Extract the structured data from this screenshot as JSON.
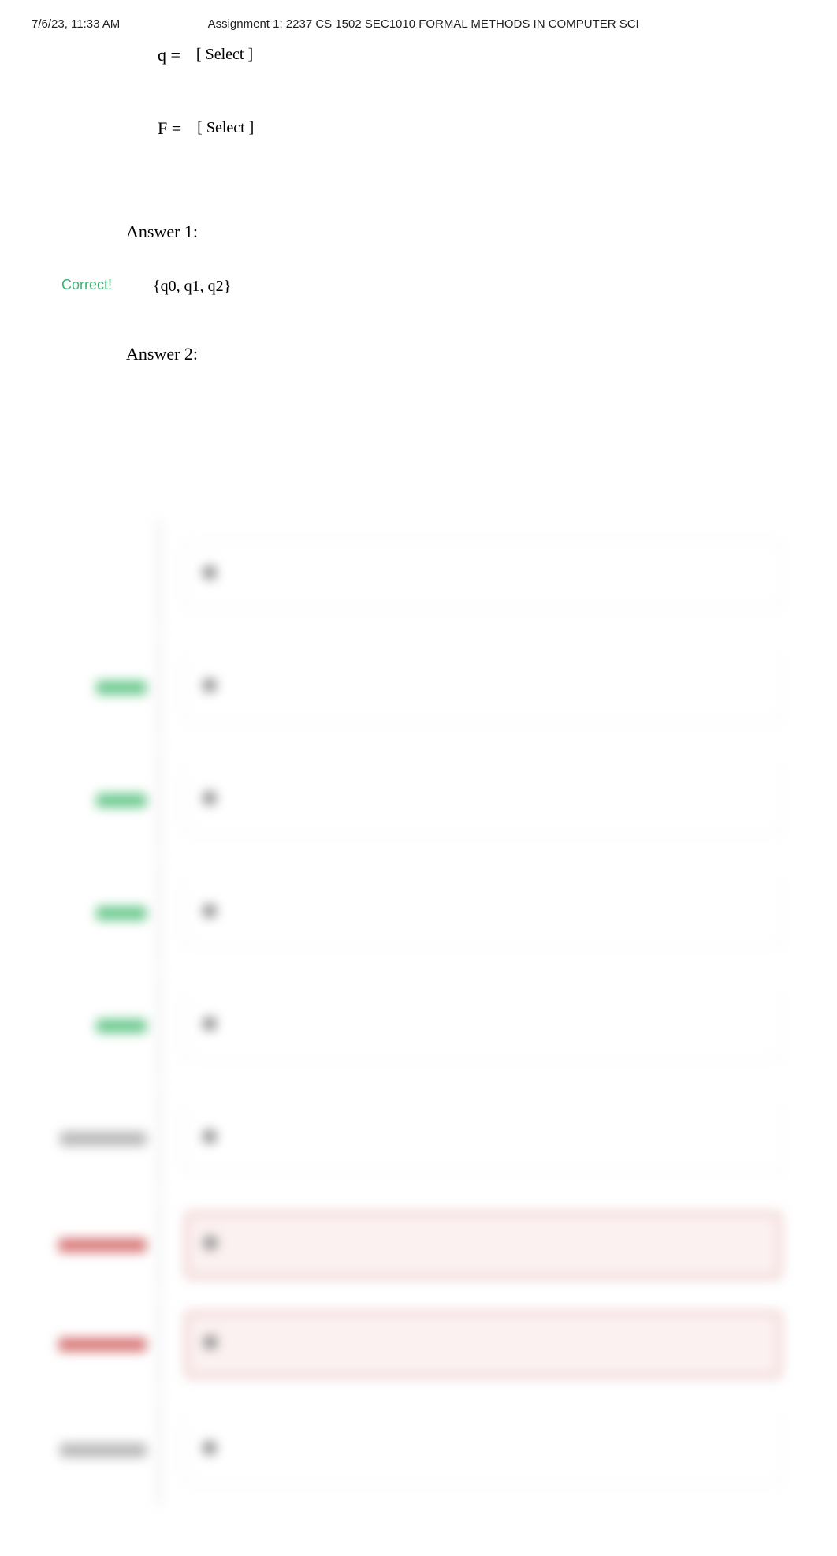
{
  "header": {
    "datetime": "7/6/23, 11:33 AM",
    "title": "Assignment 1: 2237 CS 1502 SEC1010 FORMAL METHODS IN COMPUTER SCI"
  },
  "question": {
    "lines": [
      {
        "var": "q =",
        "select_placeholder": "[ Select ]"
      },
      {
        "var": "F =",
        "select_placeholder": "[ Select ]"
      }
    ]
  },
  "answers": [
    {
      "heading": "Answer 1:",
      "status": "Correct!",
      "value": "{q0, q1, q2}"
    },
    {
      "heading": "Answer 2:",
      "status": "",
      "value": ""
    }
  ],
  "hidden_options": [
    {
      "side_style": "none",
      "box_style": "first"
    },
    {
      "side_style": "green-sm",
      "box_style": ""
    },
    {
      "side_style": "green-sm",
      "box_style": ""
    },
    {
      "side_style": "green-sm",
      "box_style": ""
    },
    {
      "side_style": "green-sm",
      "box_style": ""
    },
    {
      "side_style": "gray-l",
      "box_style": ""
    },
    {
      "side_style": "red-l",
      "box_style": "wrong"
    },
    {
      "side_style": "red-l",
      "box_style": "wrong"
    },
    {
      "side_style": "gray-l",
      "box_style": ""
    }
  ]
}
